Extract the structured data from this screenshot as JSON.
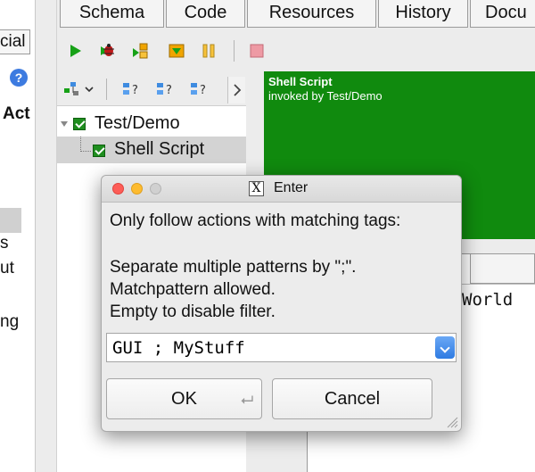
{
  "left_pane": {
    "tab_fragment": "cial",
    "act_fragment": "Act",
    "fragments": [
      "s",
      "ut",
      "ng"
    ]
  },
  "tabs": [
    {
      "label": "Schema"
    },
    {
      "label": "Code"
    },
    {
      "label": "Resources"
    },
    {
      "label": "History"
    },
    {
      "label": "Docu"
    }
  ],
  "toolbar": {
    "icons": [
      "play-icon",
      "debug-bug-icon",
      "step-icon",
      "step-out-icon",
      "pause-icon",
      "stop-icon"
    ]
  },
  "toolbar2": {
    "icons": [
      "tree-add-icon",
      "dropdown-arrow-icon",
      "find-icon",
      "find-next-icon",
      "find-prev-icon",
      "chevron-right-icon"
    ]
  },
  "tree": {
    "items": [
      {
        "label": "Test/Demo",
        "checked": true
      },
      {
        "label": "Shell Script",
        "checked": true,
        "selected": true
      }
    ]
  },
  "detail": {
    "title": "Shell Script",
    "subtitle": "invoked by Test/Demo",
    "code_fragment": "World",
    "accent_color": "#108a0e"
  },
  "dialog": {
    "title": "Enter",
    "prompt": "Only follow actions with matching tags:",
    "help_lines": [
      "Separate multiple patterns by \";\".",
      "Matchpattern allowed.",
      "Empty to disable filter."
    ],
    "input_value": "GUI ; MyStuff",
    "ok_label": "OK",
    "cancel_label": "Cancel"
  }
}
